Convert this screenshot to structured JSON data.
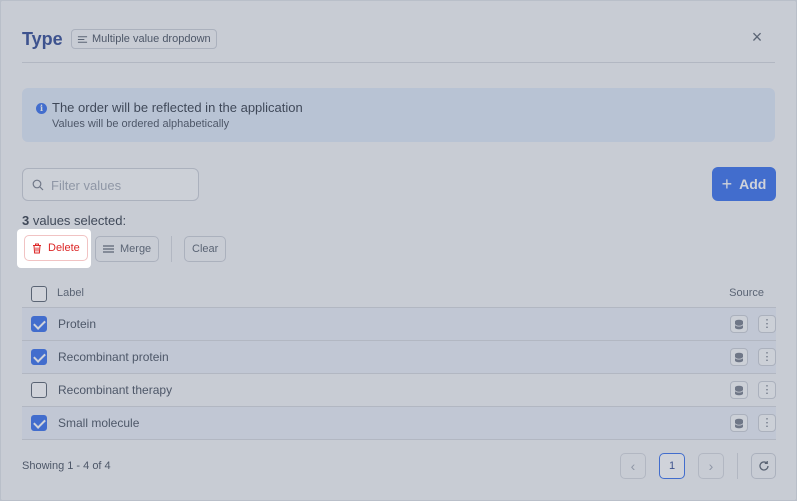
{
  "modal": {
    "title": "Type",
    "type_badge": "Multiple value dropdown",
    "close_glyph": "×"
  },
  "info": {
    "icon": "i",
    "title": "The order will be reflected in the application",
    "subtitle": "Values will be ordered alphabetically"
  },
  "filter": {
    "placeholder": "Filter values",
    "value": ""
  },
  "add_button": {
    "label": "Add",
    "plus": "+"
  },
  "selection": {
    "count": "3",
    "suffix": " values selected:"
  },
  "actions": {
    "delete": "Delete",
    "merge": "Merge",
    "clear": "Clear"
  },
  "table": {
    "headers": {
      "label": "Label",
      "source": "Source"
    },
    "rows": [
      {
        "label": "Protein",
        "checked": true
      },
      {
        "label": "Recombinant protein",
        "checked": true
      },
      {
        "label": "Recombinant therapy",
        "checked": false
      },
      {
        "label": "Small molecule",
        "checked": true
      }
    ],
    "more_glyph": "⋮"
  },
  "footer": {
    "showing": "Showing 1 - 4 of 4",
    "current_page": "1",
    "prev_glyph": "‹",
    "next_glyph": "›"
  },
  "colors": {
    "accent": "#2563eb",
    "danger": "#dc2626",
    "title": "#1e3a8a"
  }
}
